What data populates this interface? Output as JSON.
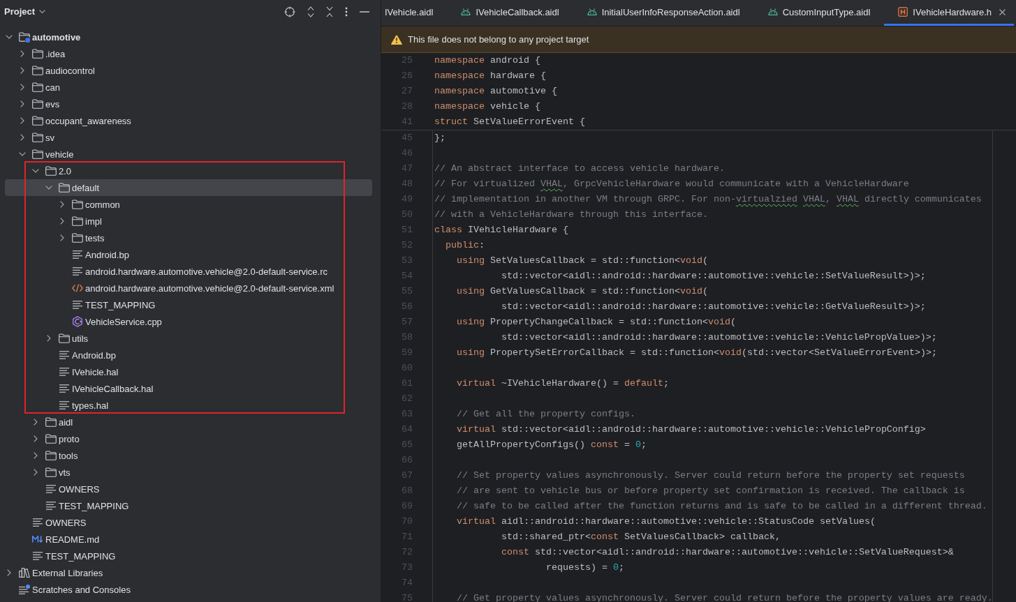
{
  "project_panel": {
    "title": "Project",
    "tree": [
      {
        "label": "automotive",
        "kind": "module",
        "expanded": true,
        "selected": false,
        "outlined": false,
        "children": [
          {
            "label": ".idea",
            "kind": "folder",
            "expanded": false,
            "selected": false,
            "outlined": false
          },
          {
            "label": "audiocontrol",
            "kind": "folder",
            "expanded": false,
            "selected": false,
            "outlined": false
          },
          {
            "label": "can",
            "kind": "folder",
            "expanded": false,
            "selected": false,
            "outlined": false
          },
          {
            "label": "evs",
            "kind": "folder",
            "expanded": false,
            "selected": false,
            "outlined": false
          },
          {
            "label": "occupant_awareness",
            "kind": "folder",
            "expanded": false,
            "selected": false,
            "outlined": false
          },
          {
            "label": "sv",
            "kind": "folder",
            "expanded": false,
            "selected": false,
            "outlined": false
          },
          {
            "label": "vehicle",
            "kind": "folder",
            "expanded": true,
            "selected": false,
            "outlined": false,
            "children": [
              {
                "label": "2.0",
                "kind": "folder",
                "expanded": true,
                "selected": false,
                "outlined": true,
                "children": [
                  {
                    "label": "default",
                    "kind": "folder",
                    "expanded": true,
                    "selected": true,
                    "outlined": false,
                    "children": [
                      {
                        "label": "common",
                        "kind": "folder",
                        "expanded": false,
                        "selected": false,
                        "outlined": false
                      },
                      {
                        "label": "impl",
                        "kind": "folder",
                        "expanded": false,
                        "selected": false,
                        "outlined": false
                      },
                      {
                        "label": "tests",
                        "kind": "folder",
                        "expanded": false,
                        "selected": false,
                        "outlined": false
                      },
                      {
                        "label": "Android.bp",
                        "kind": "text",
                        "selected": false,
                        "outlined": false
                      },
                      {
                        "label": "android.hardware.automotive.vehicle@2.0-default-service.rc",
                        "kind": "text",
                        "selected": false,
                        "outlined": false
                      },
                      {
                        "label": "android.hardware.automotive.vehicle@2.0-default-service.xml",
                        "kind": "xml",
                        "selected": false,
                        "outlined": false
                      },
                      {
                        "label": "TEST_MAPPING",
                        "kind": "text",
                        "selected": false,
                        "outlined": false
                      },
                      {
                        "label": "VehicleService.cpp",
                        "kind": "cpp",
                        "selected": false,
                        "outlined": false
                      }
                    ]
                  },
                  {
                    "label": "utils",
                    "kind": "folder",
                    "expanded": false,
                    "selected": false,
                    "outlined": false
                  },
                  {
                    "label": "Android.bp",
                    "kind": "text",
                    "selected": false,
                    "outlined": false
                  },
                  {
                    "label": "IVehicle.hal",
                    "kind": "text",
                    "selected": false,
                    "outlined": false
                  },
                  {
                    "label": "IVehicleCallback.hal",
                    "kind": "text",
                    "selected": false,
                    "outlined": false
                  },
                  {
                    "label": "types.hal",
                    "kind": "text",
                    "selected": false,
                    "outlined": false
                  }
                ]
              },
              {
                "label": "aidl",
                "kind": "folder",
                "expanded": false,
                "selected": false,
                "outlined": false
              },
              {
                "label": "proto",
                "kind": "folder",
                "expanded": false,
                "selected": false,
                "outlined": false
              },
              {
                "label": "tools",
                "kind": "folder",
                "expanded": false,
                "selected": false,
                "outlined": false
              },
              {
                "label": "vts",
                "kind": "folder",
                "expanded": false,
                "selected": false,
                "outlined": false
              },
              {
                "label": "OWNERS",
                "kind": "text",
                "selected": false,
                "outlined": false
              },
              {
                "label": "TEST_MAPPING",
                "kind": "text",
                "selected": false,
                "outlined": false
              }
            ]
          },
          {
            "label": "OWNERS",
            "kind": "text",
            "selected": false,
            "outlined": false
          },
          {
            "label": "README.md",
            "kind": "markdown",
            "selected": false,
            "outlined": false
          },
          {
            "label": "TEST_MAPPING",
            "kind": "text",
            "selected": false,
            "outlined": false
          }
        ]
      },
      {
        "label": "External Libraries",
        "kind": "libraries",
        "expanded": false,
        "selected": false,
        "outlined": false
      },
      {
        "label": "Scratches and Consoles",
        "kind": "scratches",
        "selected": false,
        "outlined": false
      }
    ]
  },
  "editor": {
    "tabs": [
      {
        "label": "IVehicle.aidl",
        "selected": false
      },
      {
        "label": "IVehicleCallback.aidl",
        "kind": "aidl",
        "selected": false
      },
      {
        "label": "InitialUserInfoResponseAction.aidl",
        "kind": "aidl",
        "selected": false
      },
      {
        "label": "CustomInputType.aidl",
        "kind": "aidl",
        "selected": false
      },
      {
        "label": "IVehicleHardware.h",
        "kind": "header",
        "selected": true
      }
    ],
    "banner": {
      "text": "This file does not belong to any project target"
    },
    "sticky_lines": [
      {
        "number": "25",
        "tokens": [
          {
            "text": "namespace",
            "kind": "keyword"
          },
          {
            "text": " android {",
            "kind": "text"
          }
        ]
      },
      {
        "number": "26",
        "tokens": [
          {
            "text": "namespace",
            "kind": "keyword"
          },
          {
            "text": " hardware {",
            "kind": "text"
          }
        ]
      },
      {
        "number": "27",
        "tokens": [
          {
            "text": "namespace",
            "kind": "keyword"
          },
          {
            "text": " automotive {",
            "kind": "text"
          }
        ]
      },
      {
        "number": "28",
        "tokens": [
          {
            "text": "namespace",
            "kind": "keyword"
          },
          {
            "text": " vehicle {",
            "kind": "text"
          }
        ]
      },
      {
        "number": "41",
        "tokens": [
          {
            "text": "struct",
            "kind": "keyword"
          },
          {
            "text": " SetValueErrorEvent {",
            "kind": "text"
          }
        ]
      }
    ],
    "lines": [
      {
        "number": "45",
        "tokens": [
          {
            "text": "};",
            "kind": "text"
          }
        ]
      },
      {
        "number": "46"
      },
      {
        "number": "47",
        "tokens": [
          {
            "text": "// An abstract interface to access vehicle hardware.",
            "kind": "comment"
          }
        ]
      },
      {
        "number": "48",
        "tokens": [
          {
            "text": "// For virtualized ",
            "kind": "comment"
          },
          {
            "text": "VHAL",
            "kind": "typo"
          },
          {
            "text": ", GrpcVehicleHardware would communicate with a VehicleHardware",
            "kind": "comment"
          }
        ]
      },
      {
        "number": "49",
        "tokens": [
          {
            "text": "// implementation in another VM through GRPC. For non-",
            "kind": "comment"
          },
          {
            "text": "virtualzied",
            "kind": "typo"
          },
          {
            "text": " VHAL",
            "kind": "typo"
          },
          {
            "text": ", ",
            "kind": "comment"
          },
          {
            "text": "VHAL",
            "kind": "typo"
          },
          {
            "text": " directly communicates",
            "kind": "comment"
          }
        ]
      },
      {
        "number": "50",
        "tokens": [
          {
            "text": "// with a VehicleHardware through this interface.",
            "kind": "comment"
          }
        ]
      },
      {
        "number": "51",
        "tokens": [
          {
            "text": "class",
            "kind": "keyword"
          },
          {
            "text": " IVehicleHardware {",
            "kind": "text"
          }
        ]
      },
      {
        "number": "52",
        "tokens": [
          {
            "text": "  public",
            "kind": "keyword"
          },
          {
            "text": ":",
            "kind": "text"
          }
        ]
      },
      {
        "number": "53",
        "tokens": [
          {
            "text": "    using",
            "kind": "keyword"
          },
          {
            "text": " SetValuesCallback = std::function<",
            "kind": "text"
          },
          {
            "text": "void",
            "kind": "keyword"
          },
          {
            "text": "(",
            "kind": "text"
          }
        ]
      },
      {
        "number": "54",
        "tokens": [
          {
            "text": "            std::vector<aidl::android::hardware::automotive::vehicle::SetValueResult>)>;",
            "kind": "text"
          }
        ]
      },
      {
        "number": "55",
        "tokens": [
          {
            "text": "    using",
            "kind": "keyword"
          },
          {
            "text": " GetValuesCallback = std::function<",
            "kind": "text"
          },
          {
            "text": "void",
            "kind": "keyword"
          },
          {
            "text": "(",
            "kind": "text"
          }
        ]
      },
      {
        "number": "56",
        "tokens": [
          {
            "text": "            std::vector<aidl::android::hardware::automotive::vehicle::GetValueResult>)>;",
            "kind": "text"
          }
        ]
      },
      {
        "number": "57",
        "tokens": [
          {
            "text": "    using",
            "kind": "keyword"
          },
          {
            "text": " PropertyChangeCallback = std::function<",
            "kind": "text"
          },
          {
            "text": "void",
            "kind": "keyword"
          },
          {
            "text": "(",
            "kind": "text"
          }
        ]
      },
      {
        "number": "58",
        "tokens": [
          {
            "text": "            std::vector<aidl::android::hardware::automotive::vehicle::VehiclePropValue>)>;",
            "kind": "text"
          }
        ]
      },
      {
        "number": "59",
        "tokens": [
          {
            "text": "    using",
            "kind": "keyword"
          },
          {
            "text": " PropertySetErrorCallback = std::function<",
            "kind": "text"
          },
          {
            "text": "void",
            "kind": "keyword"
          },
          {
            "text": "(std::vector<SetValueErrorEvent>)>;",
            "kind": "text"
          }
        ]
      },
      {
        "number": "60"
      },
      {
        "number": "61",
        "tokens": [
          {
            "text": "    virtual",
            "kind": "keyword"
          },
          {
            "text": " ~IVehicleHardware() = ",
            "kind": "text"
          },
          {
            "text": "default",
            "kind": "keyword"
          },
          {
            "text": ";",
            "kind": "text"
          }
        ]
      },
      {
        "number": "62"
      },
      {
        "number": "63",
        "tokens": [
          {
            "text": "    // Get all the property configs.",
            "kind": "comment"
          }
        ]
      },
      {
        "number": "64",
        "tokens": [
          {
            "text": "    virtual",
            "kind": "keyword"
          },
          {
            "text": " std::vector<aidl::android::hardware::automotive::vehicle::VehiclePropConfig>",
            "kind": "text"
          }
        ]
      },
      {
        "number": "65",
        "tokens": [
          {
            "text": "    getAllPropertyConfigs() ",
            "kind": "text"
          },
          {
            "text": "const",
            "kind": "keyword"
          },
          {
            "text": " = ",
            "kind": "text"
          },
          {
            "text": "0",
            "kind": "number"
          },
          {
            "text": ";",
            "kind": "text"
          }
        ]
      },
      {
        "number": "66"
      },
      {
        "number": "67",
        "tokens": [
          {
            "text": "    // Set property values asynchronously. Server could return before the property set requests",
            "kind": "comment"
          }
        ]
      },
      {
        "number": "68",
        "tokens": [
          {
            "text": "    // are sent to vehicle bus or before property set confirmation is received. The callback is",
            "kind": "comment"
          }
        ]
      },
      {
        "number": "69",
        "tokens": [
          {
            "text": "    // safe to be called after the function returns and is safe to be called in a different thread.",
            "kind": "comment"
          }
        ]
      },
      {
        "number": "70",
        "tokens": [
          {
            "text": "    virtual",
            "kind": "keyword"
          },
          {
            "text": " aidl::android::hardware::automotive::vehicle::StatusCode setValues(",
            "kind": "text"
          }
        ]
      },
      {
        "number": "71",
        "tokens": [
          {
            "text": "            std::shared_ptr<",
            "kind": "text"
          },
          {
            "text": "const",
            "kind": "keyword"
          },
          {
            "text": " SetValuesCallback> callback,",
            "kind": "text"
          }
        ]
      },
      {
        "number": "72",
        "tokens": [
          {
            "text": "            const",
            "kind": "keyword"
          },
          {
            "text": " std::vector<aidl::android::hardware::automotive::vehicle::SetValueRequest>&",
            "kind": "text"
          }
        ]
      },
      {
        "number": "73",
        "tokens": [
          {
            "text": "                    requests) = ",
            "kind": "text"
          },
          {
            "text": "0",
            "kind": "number"
          },
          {
            "text": ";",
            "kind": "text"
          }
        ]
      },
      {
        "number": "74"
      },
      {
        "number": "75",
        "tokens": [
          {
            "text": "    // Get property values asynchronously. Server could return before the property values are ready.",
            "kind": "comment"
          }
        ]
      }
    ]
  }
}
